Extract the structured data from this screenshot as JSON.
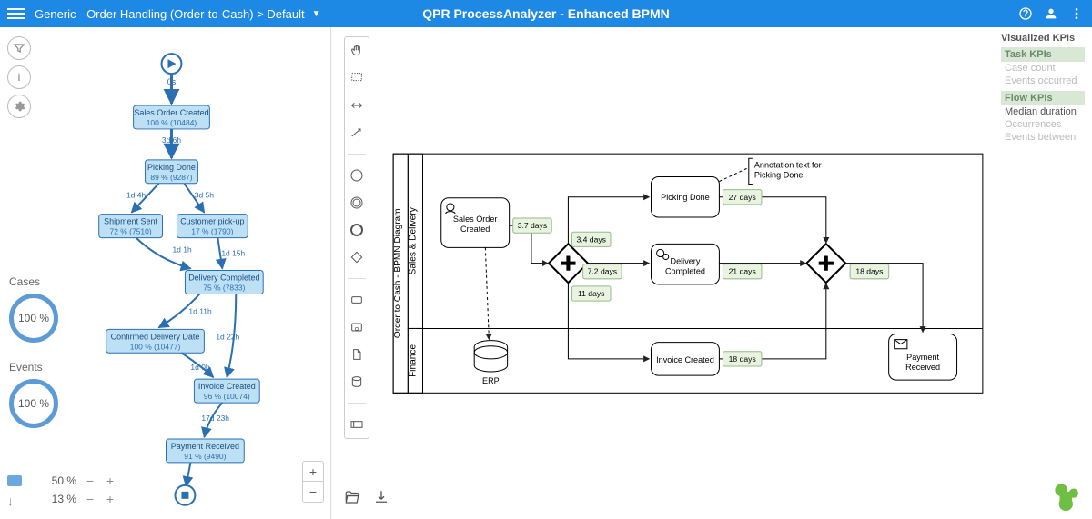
{
  "header": {
    "breadcrumb": "Generic - Order Handling (Order-to-Cash) > Default",
    "title": "QPR ProcessAnalyzer - Enhanced BPMN"
  },
  "left": {
    "kpi_cases_label": "Cases",
    "kpi_cases_value": "100 %",
    "kpi_events_label": "Events",
    "kpi_events_value": "100 %",
    "slider_bar_value": "50 %",
    "slider_arrow_value": "13 %"
  },
  "flowchart": {
    "start_label": "0s",
    "nodes": {
      "sales_order_created": {
        "title": "Sales Order Created",
        "sub": "100 % (10484)"
      },
      "picking_done": {
        "title": "Picking Done",
        "sub": "89 % (9287)"
      },
      "shipment_sent": {
        "title": "Shipment Sent",
        "sub": "72 % (7510)"
      },
      "customer_pickup": {
        "title": "Customer pick-up",
        "sub": "17 % (1790)"
      },
      "delivery_completed": {
        "title": "Delivery Completed",
        "sub": "75 % (7833)"
      },
      "confirmed_delivery": {
        "title": "Confirmed Delivery Date",
        "sub": "100 % (10477)"
      },
      "invoice_created": {
        "title": "Invoice Created",
        "sub": "96 % (10074)"
      },
      "payment_received": {
        "title": "Payment Received",
        "sub": "91 % (9490)"
      }
    },
    "edges": {
      "e1": "3d 6h",
      "e2a": "1d 4h",
      "e2b": "3d 5h",
      "e3a": "1d 1h",
      "e3b": "1d 15h",
      "e4": "1d 11h",
      "e5": "1d 22h",
      "e6": "1d 0h",
      "e7": "17d 23h"
    }
  },
  "bpmn": {
    "pool_label": "Order to Cash - BPMN Diagram",
    "lane_top": "Sales & Delivery",
    "lane_bottom": "Finance",
    "tasks": {
      "sales_order_created": "Sales Order Created",
      "picking_done": "Picking Done",
      "delivery_completed": "Delivery Completed",
      "invoice_created": "Invoice Created",
      "payment_received": "Payment Received"
    },
    "data_store": "ERP",
    "annotation": "Annotation text for Picking Done",
    "durations": {
      "d1": "3.7 days",
      "d2": "3.4 days",
      "d3": "7.2 days",
      "d4": "11 days",
      "d5": "27 days",
      "d6": "21 days",
      "d7": "18 days",
      "d8": "18 days"
    }
  },
  "legend": {
    "heading": "Visualized KPIs",
    "task_h": "Task KPIs",
    "task_items": [
      "Case count",
      "Events occurred"
    ],
    "flow_h": "Flow KPIs",
    "flow_items": [
      "Median duration",
      "Occurrences",
      "Events between"
    ]
  }
}
